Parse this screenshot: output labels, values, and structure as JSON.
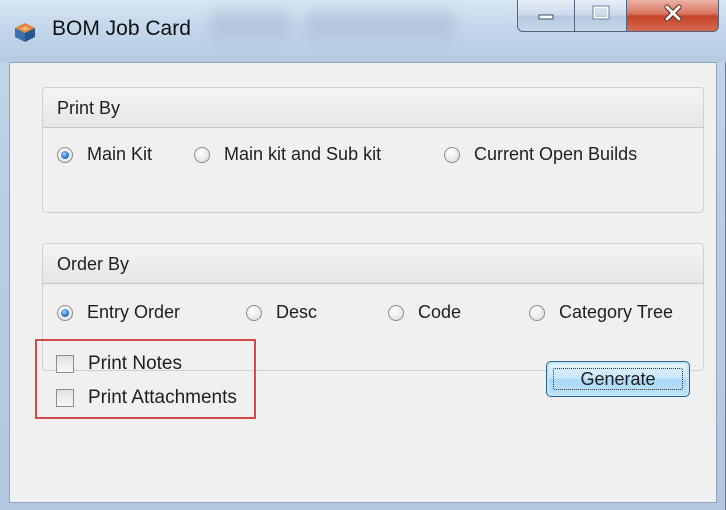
{
  "window": {
    "title": "BOM Job Card",
    "icon": "bom-cube-icon",
    "caption_icons": [
      "minimize-icon",
      "maximize-icon",
      "close-icon"
    ],
    "close_color": "#c5442a"
  },
  "print_by": {
    "title": "Print By",
    "options": [
      {
        "label": "Main Kit",
        "checked": true
      },
      {
        "label": "Main kit and Sub kit",
        "checked": false
      },
      {
        "label": "Current Open Builds",
        "checked": false
      }
    ]
  },
  "order_by": {
    "title": "Order By",
    "options": [
      {
        "label": "Entry Order",
        "checked": true
      },
      {
        "label": "Desc",
        "checked": false
      },
      {
        "label": "Code",
        "checked": false
      },
      {
        "label": "Category Tree",
        "checked": false
      }
    ]
  },
  "checkboxes": [
    {
      "label": "Print Notes",
      "checked": false
    },
    {
      "label": "Print Attachments",
      "checked": false
    }
  ],
  "generate_label": "Generate",
  "colors": {
    "highlight_border": "#d64a4a",
    "button_fill": "#c6e6fb",
    "radio_selected": "#2b76c7"
  }
}
